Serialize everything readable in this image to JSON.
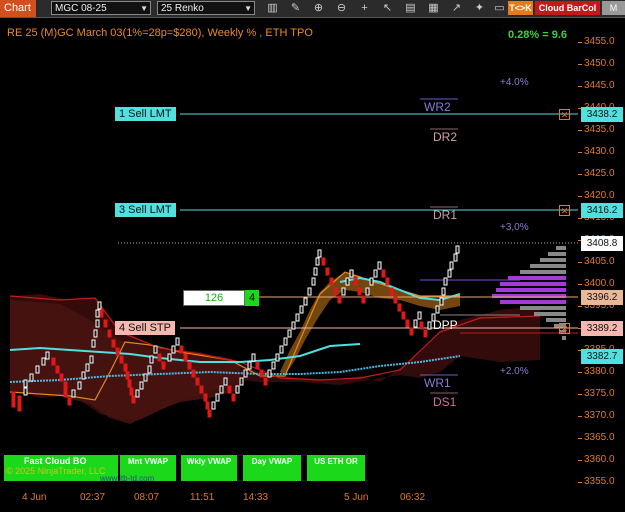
{
  "toolbar": {
    "chart_tab": "Chart",
    "instrument": "MGC 08-25",
    "bar_type": "25 Renko",
    "tk_label": "T<>K",
    "cloud_label": "Cloud BarCol",
    "m_label": "M",
    "icons": [
      "draw-icon",
      "zoom-in-icon",
      "zoom-out-icon",
      "crosshair-icon",
      "pointer-icon",
      "hand-icon",
      "bar-style-icon",
      "indicators-icon",
      "strategy-icon",
      "template-icon"
    ]
  },
  "header": {
    "title": "RE 25 (M)GC March 03(1%=28p=$280), Weekly % , ETH TPO",
    "pct_label": "0.28% = 9.6"
  },
  "levels": {
    "plus4": "+4.0%",
    "wr2": "WR2",
    "dr2": "DR2",
    "dr1": "DR1",
    "plus3": "+3,0%",
    "dpp": "DPP",
    "wr1": "WR1",
    "ds1": "DS1",
    "plus2": "+2.0%"
  },
  "orders": [
    {
      "label": "1 Sell LMT",
      "price": "3438.2"
    },
    {
      "label": "3 Sell LMT",
      "price": "3416.2"
    },
    {
      "label": "4 Sell STP",
      "price": "3389.2"
    }
  ],
  "position": {
    "qty": "126",
    "count": "4",
    "price": "3396.2"
  },
  "price_labels": {
    "last": "3408.8",
    "vwap": "3382.7"
  },
  "y_axis": {
    "ticks": [
      "3455.0",
      "3450.0",
      "3445.0",
      "3440.0",
      "3435.0",
      "3430.0",
      "3425.0",
      "3420.0",
      "3415.0",
      "3410.0",
      "3405.0",
      "3400.0",
      "3395.0",
      "3390.0",
      "3385.0",
      "3380.0",
      "3375.0",
      "3370.0",
      "3365.0",
      "3360.0",
      "3355.0"
    ]
  },
  "x_axis": {
    "ticks": [
      "4 Jun",
      "02:37",
      "08:07",
      "11:51",
      "14:33",
      "5 Jun",
      "06:32"
    ]
  },
  "buttons": {
    "fast_cloud": "Fast Cloud BO",
    "mnt_vwap": "Mnt VWAP",
    "wkly_vwap": "Wkly VWAP",
    "day_vwap": "Day VWAP",
    "us_eth_or": "US ETH OR"
  },
  "footer": {
    "copyright": "© 2025 NinjaTrader, LLC",
    "watermark": "www.itb-td.com"
  },
  "colors": {
    "accent_orange": "#e07a2a",
    "order_cyan": "#4fe0e0",
    "stop_pink": "#f4b8b0",
    "button_green": "#1bd81b",
    "cloud_red": "#c21a1a"
  }
}
